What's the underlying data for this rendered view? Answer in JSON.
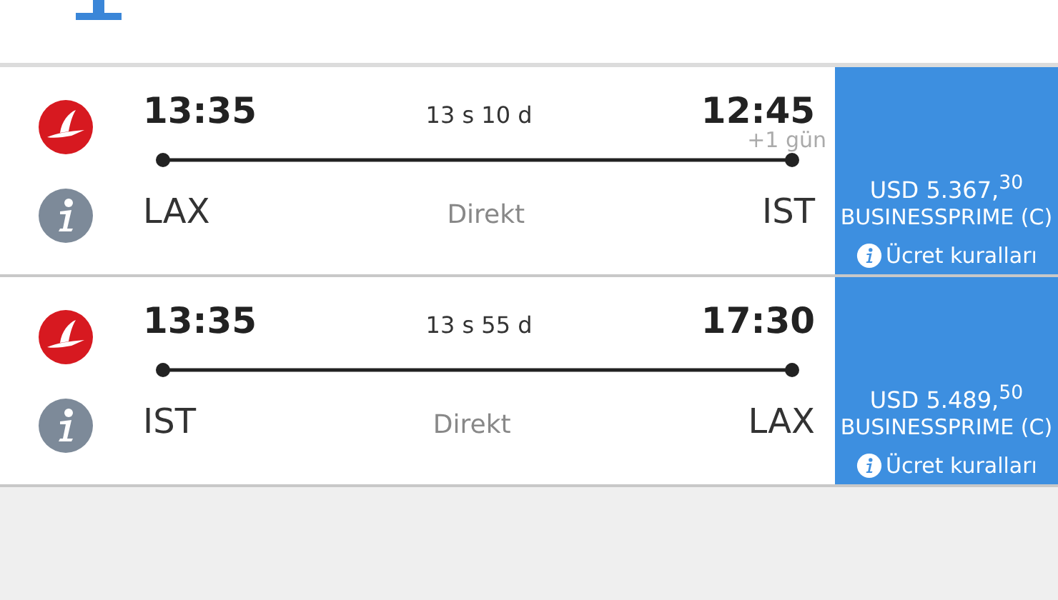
{
  "flights": [
    {
      "departure_time": "13:35",
      "duration": "13 s 10 d",
      "arrival_time": "12:45",
      "day_offset": "+1 gün",
      "origin": "LAX",
      "stops": "Direkt",
      "destination": "IST",
      "price": "USD 5.367,$^{30}$",
      "fare_class": "BUSINESSPRIME (C)",
      "fare_rules": "Ücret kuralları"
    },
    {
      "departure_time": "13:35",
      "duration": "13 s 55 d",
      "arrival_time": "17:30",
      "origin": "IST",
      "stops": "Direkt",
      "destination": "LAX",
      "price": "USD 5.489,$^{50}$",
      "fare_class": "BUSINESSPRIME (C)",
      "fare_rules": "Ücret kuralları"
    }
  ]
}
